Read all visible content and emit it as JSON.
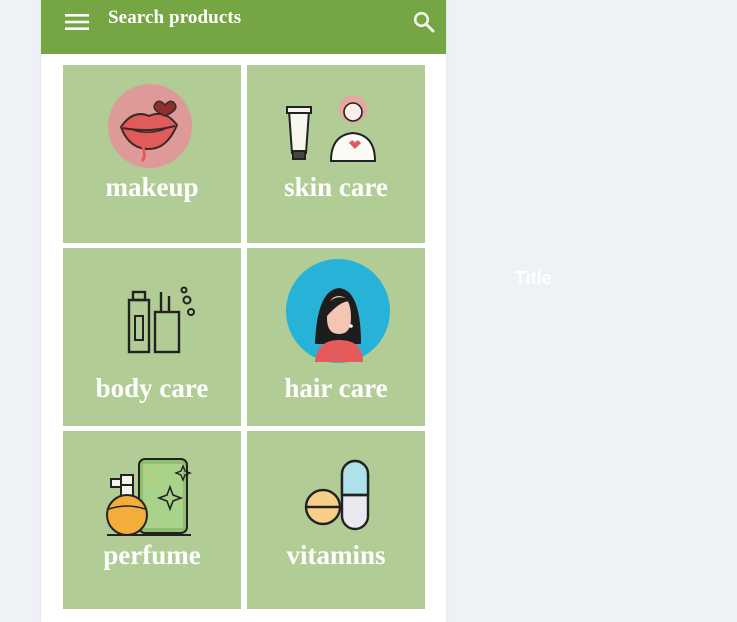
{
  "appbar": {
    "search_placeholder": "Search products",
    "menu_icon": "menu-icon",
    "search_icon": "search-icon",
    "color": "#76a544"
  },
  "categories": [
    {
      "label": "makeup",
      "icon": "lips-icon"
    },
    {
      "label": "skin care",
      "icon": "skin-care-icon"
    },
    {
      "label": "body care",
      "icon": "body-care-icon"
    },
    {
      "label": "hair care",
      "icon": "hair-care-icon"
    },
    {
      "label": "perfume",
      "icon": "perfume-icon"
    },
    {
      "label": "vitamins",
      "icon": "vitamins-icon"
    }
  ],
  "tile_color": "#b1cc94",
  "side_title": "Title"
}
